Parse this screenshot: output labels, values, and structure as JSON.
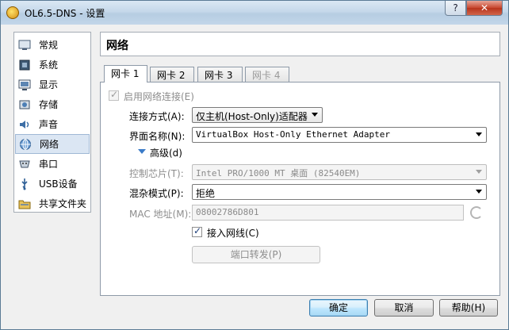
{
  "window": {
    "title": "OL6.5-DNS - 设置",
    "help_label": "?",
    "close_label": "✕"
  },
  "sidebar": {
    "items": [
      {
        "label": "常规",
        "icon": "general-icon"
      },
      {
        "label": "系统",
        "icon": "system-icon"
      },
      {
        "label": "显示",
        "icon": "display-icon"
      },
      {
        "label": "存储",
        "icon": "storage-icon"
      },
      {
        "label": "声音",
        "icon": "audio-icon"
      },
      {
        "label": "网络",
        "icon": "network-icon",
        "selected": true
      },
      {
        "label": "串口",
        "icon": "serial-port-icon"
      },
      {
        "label": "USB设备",
        "icon": "usb-icon"
      },
      {
        "label": "共享文件夹",
        "icon": "shared-folder-icon"
      }
    ]
  },
  "page": {
    "title": "网络"
  },
  "tabs": [
    {
      "label": "网卡 1",
      "active": true
    },
    {
      "label": "网卡 2"
    },
    {
      "label": "网卡 3"
    },
    {
      "label": "网卡 4",
      "disabled": true
    }
  ],
  "adapter": {
    "enable_label": "启用网络连接(E)",
    "enable_checked": true,
    "attached_to_label": "连接方式(A):",
    "attached_to_value": "仅主机(Host-Only)适配器",
    "name_label": "界面名称(N):",
    "name_value": "VirtualBox Host-Only Ethernet Adapter",
    "advanced_label": "高级(d)",
    "adapter_type_label": "控制芯片(T):",
    "adapter_type_value": "Intel PRO/1000 MT 桌面 (82540EM)",
    "promiscuous_label": "混杂模式(P):",
    "promiscuous_value": "拒绝",
    "mac_label": "MAC 地址(M):",
    "mac_value": "08002786D801",
    "cable_label": "接入网线(C)",
    "cable_checked": true,
    "port_forwarding_label": "端口转发(P)"
  },
  "buttons": {
    "ok": "确定",
    "cancel": "取消",
    "help": "帮助(H)"
  },
  "colors": {
    "accent": "#3c7fb1",
    "selection": "#dbe6f3",
    "titlebar": "#c5d8ea"
  }
}
